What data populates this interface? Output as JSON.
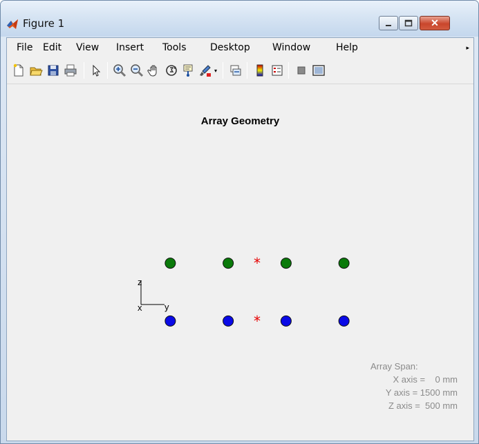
{
  "window": {
    "title": "Figure 1",
    "close_glyph": "✕"
  },
  "menu": {
    "items": [
      "File",
      "Edit",
      "View",
      "Insert",
      "Tools",
      "Desktop",
      "Window",
      "Help"
    ],
    "overflow_glyph": "▸"
  },
  "toolbar": {
    "icons": [
      "new-figure-icon",
      "open-file-icon",
      "save-icon",
      "print-icon",
      "edit-plot-arrow-icon",
      "zoom-in-icon",
      "zoom-out-icon",
      "pan-hand-icon",
      "rotate-3d-icon",
      "data-cursor-icon",
      "brush-icon",
      "link-plot-icon",
      "colorbar-icon",
      "legend-icon",
      "hide-plot-tools-icon",
      "show-plot-tools-icon"
    ]
  },
  "plot": {
    "title": "Array Geometry",
    "axes_labels": {
      "z": "z",
      "x": "x",
      "y": "y"
    },
    "colors": {
      "top_row": "#0a7a0a",
      "bottom_row": "#0a0ae6",
      "phase_center": "#e60000"
    },
    "elements": {
      "y_positions_mm": [
        -750,
        -250,
        250,
        750
      ],
      "z_positions_mm": [
        250,
        -250
      ],
      "phase_center_marker": "*"
    },
    "span": {
      "title": "Array Span:",
      "x_line": "X axis =    0 mm",
      "y_line": "Y axis = 1500 mm",
      "z_line": "Z axis =  500 mm"
    }
  }
}
